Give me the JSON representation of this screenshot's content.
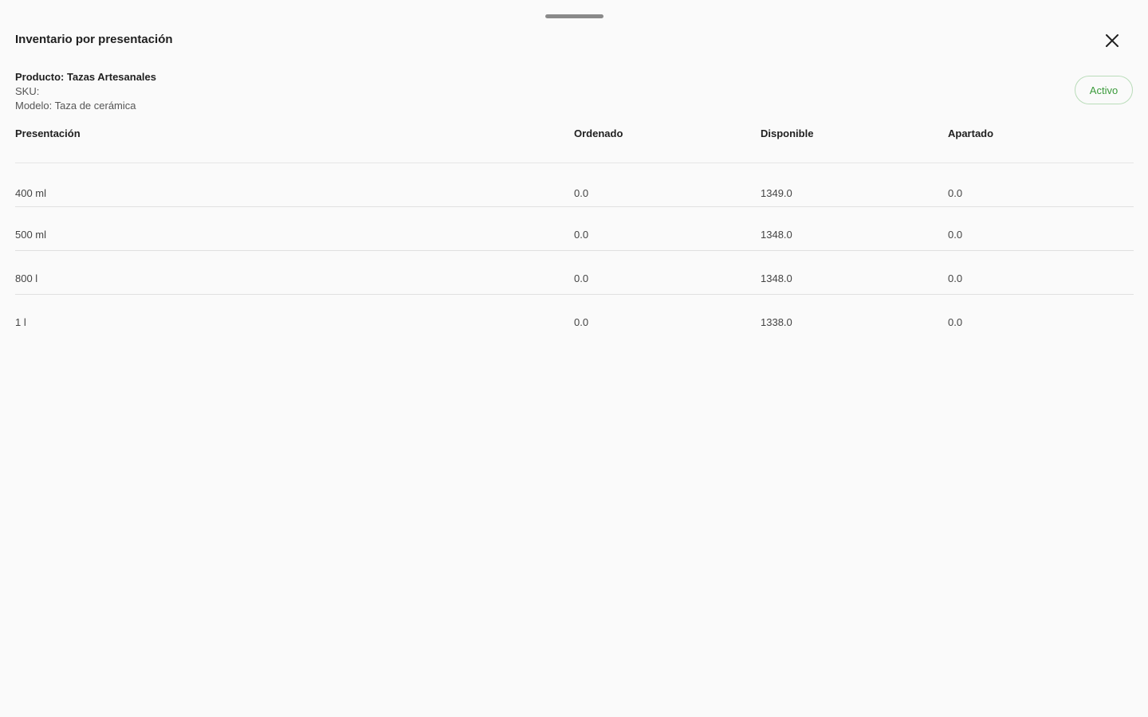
{
  "sheet": {
    "title": "Inventario por presentación",
    "close_icon": "close-icon"
  },
  "product": {
    "name_line": "Producto: Tazas Artesanales",
    "sku_line": "SKU:",
    "model_line": "Modelo: Taza de cerámica",
    "status": "Activo"
  },
  "colors": {
    "status_text": "#3a9a3a",
    "status_border": "#b9dcb9",
    "background": "#fafafa"
  },
  "table": {
    "headers": [
      "Presentación",
      "Ordenado",
      "Disponible",
      "Apartado"
    ],
    "rows": [
      [
        "400 ml",
        "0.0",
        "1349.0",
        "0.0"
      ],
      [
        "500 ml",
        "0.0",
        "1348.0",
        "0.0"
      ],
      [
        "800 l",
        "0.0",
        "1348.0",
        "0.0"
      ],
      [
        "1 l",
        "0.0",
        "1338.0",
        "0.0"
      ]
    ]
  }
}
